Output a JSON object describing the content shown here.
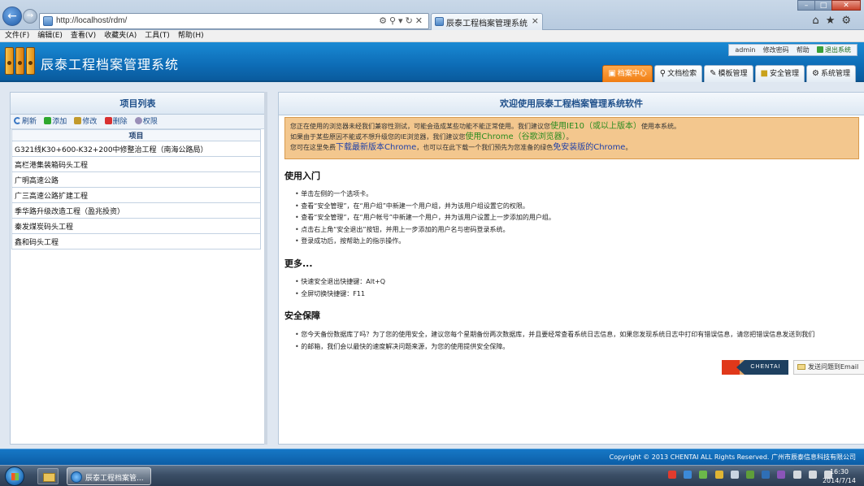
{
  "browser": {
    "url": "http://localhost/rdm/",
    "tab_title": "辰泰工程档案管理系统",
    "menu": [
      "文件(F)",
      "编辑(E)",
      "查看(V)",
      "收藏夹(A)",
      "工具(T)",
      "帮助(H)"
    ]
  },
  "header": {
    "title": "辰泰工程档案管理系统",
    "user": "admin",
    "change_password": "修改密码",
    "help": "帮助",
    "logout": "退出系统"
  },
  "main_tabs": [
    {
      "label": "档案中心",
      "icon": "archive-icon",
      "active": true
    },
    {
      "label": "文档检索",
      "icon": "magnifier-icon",
      "active": false
    },
    {
      "label": "模板管理",
      "icon": "template-icon",
      "active": false
    },
    {
      "label": "安全管理",
      "icon": "lock-icon",
      "active": false
    },
    {
      "label": "系统管理",
      "icon": "gear-icon",
      "active": false
    }
  ],
  "left_panel": {
    "title": "项目列表",
    "toolbar": [
      "刷新",
      "添加",
      "修改",
      "删除",
      "权限"
    ],
    "column_header": "项目",
    "items": [
      "G321线K30+600-K32+200中修整治工程（南海公路局）",
      "高栏港集装箱码头工程",
      "广明高速公路",
      "广三高速公路扩建工程",
      "季华路升级改造工程（盈兆投资）",
      "秦发煤炭码头工程",
      "鑫和码头工程"
    ]
  },
  "right_panel": {
    "title": "欢迎使用辰泰工程档案管理系统软件",
    "notice": {
      "l1_a": "您正在使用的浏览器未经我们兼容性测试，可能会造成某些功能不能正常使用。我们建议您",
      "l1_hl": "使用IE10（或以上版本）",
      "l1_b": "使用本系统。",
      "l2_a": "如果由于某些原因不能或不想升级您的IE浏览器，我们建议您",
      "l2_hl": "使用Chrome（谷歌浏览器）",
      "l2_b": "。",
      "l3_a": "您可在这里免费",
      "l3_link1": "下载最新版本Chrome",
      "l3_b": "，也可以在此下载一个我们预先为您准备的绿色",
      "l3_link2": "免安装版的Chrome",
      "l3_c": "。"
    },
    "sections": {
      "getting_started": {
        "title": "使用入门",
        "items": [
          "单击左侧的一个选项卡。",
          "查看“安全管理”，在“用户组”中新建一个用户组，并为该用户组设置它的权限。",
          "查看“安全管理”，在“用户帐号”中新建一个用户，并为该用户设置上一步添加的用户组。",
          "点击右上角“安全退出”按钮，并用上一步添加的用户名与密码登录系统。",
          "登录成功后，按帮助上的指示操作。"
        ]
      },
      "more": {
        "title": "更多...",
        "items": [
          "快速安全退出快捷键：Alt+Q",
          "全屏切换快捷键：F11"
        ]
      },
      "security": {
        "title": "安全保障",
        "line1": "您今天备份数据库了吗？为了您的使用安全，建议您每个星期备份两次数据库，并且要经常查看系统日志信息，如果您发现系统日志中打印有错误信息，请您把错误信息发送到我们",
        "line2": "的邮箱，我们会以最快的速度解决问题来源，为您的使用提供安全保障。"
      }
    },
    "brand_logo": "CHENTAI",
    "email_button": "发送问题到Email"
  },
  "footer": {
    "copyright": "Copyright © 2013 CHENTAI ALL Rights Reserved. 广州市辰泰信息科技有限公司"
  },
  "taskbar": {
    "ie_window_label": "辰泰工程档案管...",
    "time": "16:30",
    "date": "2014/7/14"
  }
}
